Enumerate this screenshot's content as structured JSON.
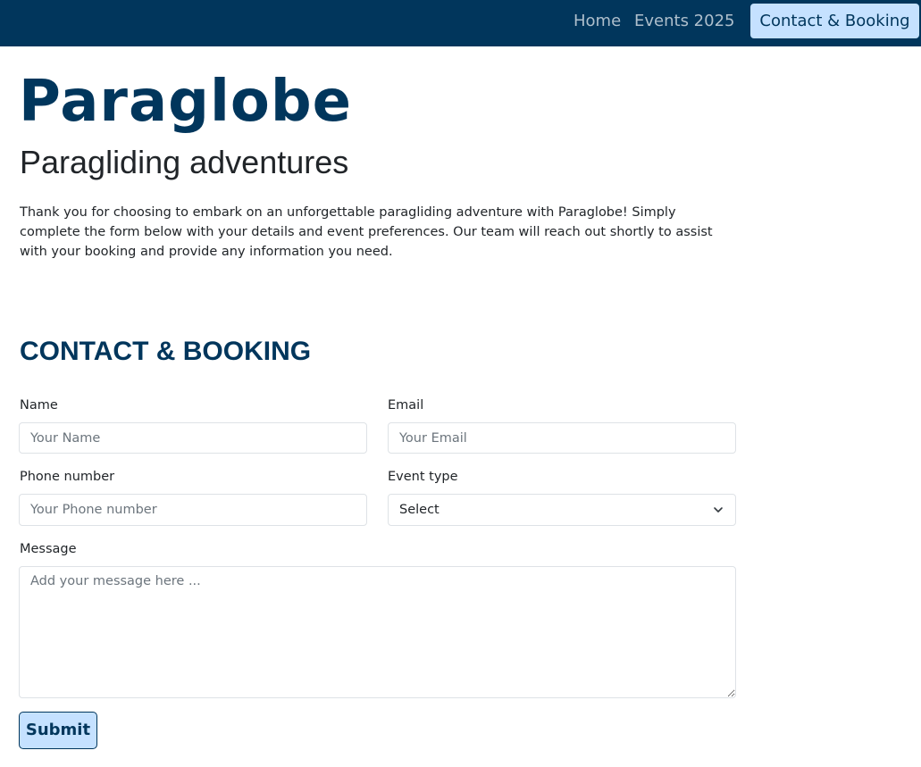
{
  "nav": {
    "home": "Home",
    "events": "Events 2025",
    "contact": "Contact & Booking"
  },
  "brand": {
    "name": "Paraglobe",
    "tagline": "Paragliding adventures"
  },
  "intro": "Thank you for choosing to embark on an unforgettable paragliding adventure with Paraglobe! Simply complete the form below with your details and event preferences. Our team will reach out shortly to assist with your booking and provide any information you need.",
  "form": {
    "title": "CONTACT & BOOKING",
    "name_label": "Name",
    "name_placeholder": "Your Name",
    "email_label": "Email",
    "email_placeholder": "Your Email",
    "phone_label": "Phone number",
    "phone_placeholder": "Your Phone number",
    "event_label": "Event type",
    "event_selected": "Select",
    "message_label": "Message",
    "message_placeholder": "Add your message here ...",
    "submit_label": "Submit"
  },
  "colors": {
    "navbar": "#01365c",
    "accent": "#c5e1ff",
    "brand": "#01365c"
  },
  "icons": {
    "select_arrow": "chevron-down-icon"
  }
}
